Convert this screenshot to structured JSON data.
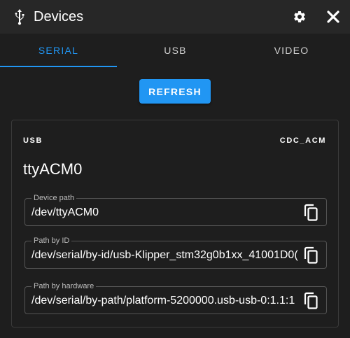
{
  "window": {
    "title": "Devices",
    "title_icon": "usb-icon",
    "settings_icon": "gear-icon",
    "close_icon": "close-icon"
  },
  "tabs": [
    {
      "label": "SERIAL",
      "active": true
    },
    {
      "label": "USB",
      "active": false
    },
    {
      "label": "VIDEO",
      "active": false
    }
  ],
  "refresh_label": "REFRESH",
  "device": {
    "bus": "USB",
    "driver": "CDC_ACM",
    "name": "ttyACM0",
    "fields": [
      {
        "label": "Device path",
        "value": "/dev/ttyACM0"
      },
      {
        "label": "Path by ID",
        "value": "/dev/serial/by-id/usb-Klipper_stm32g0b1xx_41001D0("
      },
      {
        "label": "Path by hardware",
        "value": "/dev/serial/by-path/platform-5200000.usb-usb-0:1.1:1"
      }
    ],
    "copy_icon": "copy-icon"
  },
  "colors": {
    "accent": "#2196f3",
    "background": "#1e1e1e",
    "titlebar": "#272727"
  }
}
